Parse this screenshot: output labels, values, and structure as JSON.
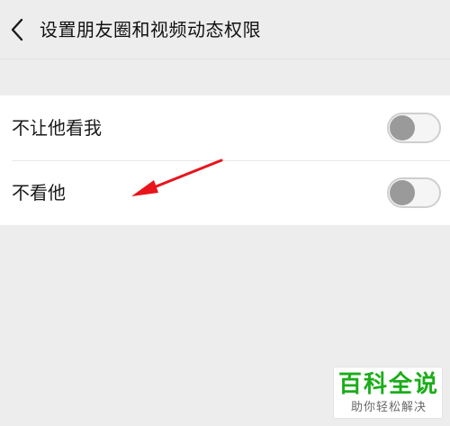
{
  "header": {
    "back_icon": "chevron-left-icon",
    "title": "设置朋友圈和视频动态权限"
  },
  "settings": [
    {
      "label": "不让他看我",
      "enabled": false
    },
    {
      "label": "不看他",
      "enabled": false
    }
  ],
  "annotation": {
    "icon": "red-arrow-icon",
    "color": "#e8141b"
  },
  "watermark": {
    "title": "百科全说",
    "subtitle": "助你轻松解决",
    "title_color": "#1aad19"
  },
  "colors": {
    "background": "#ededed",
    "card": "#ffffff",
    "toggle_off_knob": "#9a9a9a"
  }
}
